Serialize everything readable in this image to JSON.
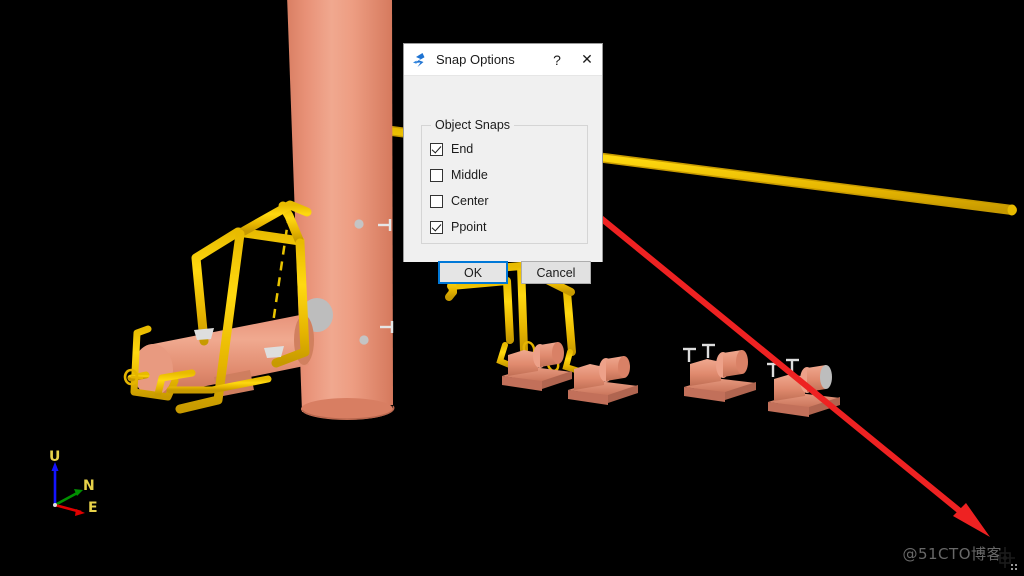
{
  "app": {
    "background_color": "#000000",
    "viewport_name": "3d-model-viewport"
  },
  "dialog": {
    "title": "Snap Options",
    "icon_name": "snap-icon",
    "help_label": "?",
    "close_label": "✕",
    "group": {
      "title": "Object Snaps",
      "options": [
        {
          "label": "End",
          "checked": true
        },
        {
          "label": "Middle",
          "checked": false
        },
        {
          "label": "Center",
          "checked": false
        },
        {
          "label": "Ppoint",
          "checked": true
        }
      ]
    },
    "buttons": {
      "ok": "OK",
      "cancel": "Cancel"
    },
    "accent_color": "#0078d7",
    "face_color": "#f0f0f0"
  },
  "axis_triad": {
    "name": "view-orientation-triad",
    "axes": [
      {
        "label": "U",
        "color": "#0000ff",
        "direction": "up"
      },
      {
        "label": "N",
        "color": "#00a000",
        "direction": "up-right"
      },
      {
        "label": "E",
        "color": "#e00000",
        "direction": "right-down"
      }
    ],
    "label_color": "#e8d24a"
  },
  "annotation": {
    "arrow_color": "#ee2222",
    "arrow_name": "red-pointer-arrow"
  },
  "model": {
    "pipe_color": "#f2c200",
    "equipment_color": "#e8947a",
    "nozzle_color": "#c9c9c9",
    "items": [
      "vertical-column",
      "horizontal-vessel",
      "pump-1",
      "pump-2",
      "pump-3",
      "pump-4",
      "pipe-rack-header",
      "long-header-pipe"
    ]
  },
  "watermark": {
    "text": "@51CTO博客"
  },
  "cursor": {
    "name": "crosshair-box-cursor"
  }
}
